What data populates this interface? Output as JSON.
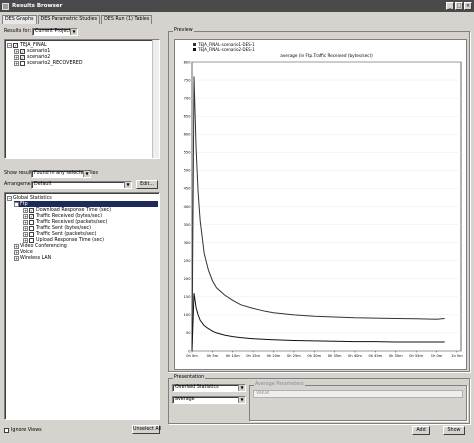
{
  "window": {
    "title": "Results Browser"
  },
  "tabs": [
    "DES Graphs",
    "DES Parametric Studies",
    "DES Run (1) Tables"
  ],
  "results_for": {
    "label": "Results for:",
    "value": "Current Project"
  },
  "project_tree": {
    "root": "TEJA_FINAL",
    "children": [
      "scenario1",
      "scenario2",
      "scenario2_RECOVERED"
    ]
  },
  "show_results": {
    "label": "Show results:",
    "value": "Found in any selected files"
  },
  "arrangement": {
    "label": "Arrangement:",
    "value": "Default",
    "edit_label": "Edit..."
  },
  "stats_tree": {
    "root": "Global Statistics",
    "group": "Ftp",
    "items": [
      "Download Response Time (sec)",
      "Traffic Received (bytes/sec)",
      "Traffic Received (packets/sec)",
      "Traffic Sent (bytes/sec)",
      "Traffic Sent (packets/sec)",
      "Upload Response Time (sec)"
    ],
    "siblings": [
      "Video Conferencing",
      "Voice",
      "Wireless LAN"
    ]
  },
  "ignore_views_label": "Ignore Views",
  "unselect_all_label": "Unselect All",
  "preview": {
    "title": "Preview"
  },
  "presentation": {
    "title": "Presentation",
    "value1": "Overlaid Statistics",
    "value2": "average",
    "avg_params_label": "Average Parameters",
    "value_label": "Value"
  },
  "buttons": {
    "add": "Add",
    "show": "Show"
  },
  "colors": {
    "series1": "#333333",
    "series2": "#111111",
    "titlebar": "#4a4a4a"
  },
  "chart_data": {
    "type": "line",
    "title": "average (in Ftp.Traffic Received (bytes/sec))",
    "legend": [
      "TEJA_FINAL-scenario1-DES-1",
      "TEJA_FINAL-scenario2-DES-1"
    ],
    "xlabel": "",
    "ylabel": "",
    "xlim": [
      0,
      66
    ],
    "ylim": [
      0,
      800
    ],
    "x_ticks": [
      "0h 0m",
      "0h 5m",
      "0h 10m",
      "0h 15m",
      "0h 20m",
      "0h 25m",
      "0h 30m",
      "0h 35m",
      "0h 40m",
      "0h 45m",
      "0h 50m",
      "0h 55m",
      "1h 0m",
      "1h 5m"
    ],
    "x_tick_values": [
      0,
      5,
      10,
      15,
      20,
      25,
      30,
      35,
      40,
      45,
      50,
      55,
      60,
      65
    ],
    "y_ticks": [
      0,
      50,
      100,
      150,
      200,
      250,
      300,
      350,
      400,
      450,
      500,
      550,
      600,
      650,
      700,
      750,
      800
    ],
    "series": [
      {
        "name": "TEJA_FINAL-scenario1-DES-1",
        "x": [
          0,
          0.5,
          1,
          1.5,
          2,
          3,
          4,
          5,
          6,
          8,
          10,
          12,
          15,
          18,
          20,
          25,
          30,
          35,
          40,
          45,
          50,
          55,
          60,
          62
        ],
        "values": [
          0,
          760,
          560,
          440,
          360,
          270,
          225,
          195,
          175,
          155,
          140,
          128,
          118,
          110,
          106,
          100,
          96,
          94,
          92,
          91,
          90,
          89,
          88,
          90
        ]
      },
      {
        "name": "TEJA_FINAL-scenario2-DES-1",
        "x": [
          0,
          0.5,
          1,
          1.5,
          2,
          3,
          4,
          5,
          6,
          8,
          10,
          12,
          15,
          18,
          20,
          25,
          30,
          35,
          40,
          45,
          50,
          55,
          60,
          62
        ],
        "values": [
          0,
          160,
          120,
          100,
          85,
          70,
          62,
          55,
          50,
          44,
          40,
          37,
          34,
          32,
          31,
          29,
          28,
          27,
          26,
          26,
          25,
          25,
          25,
          25
        ]
      }
    ]
  }
}
